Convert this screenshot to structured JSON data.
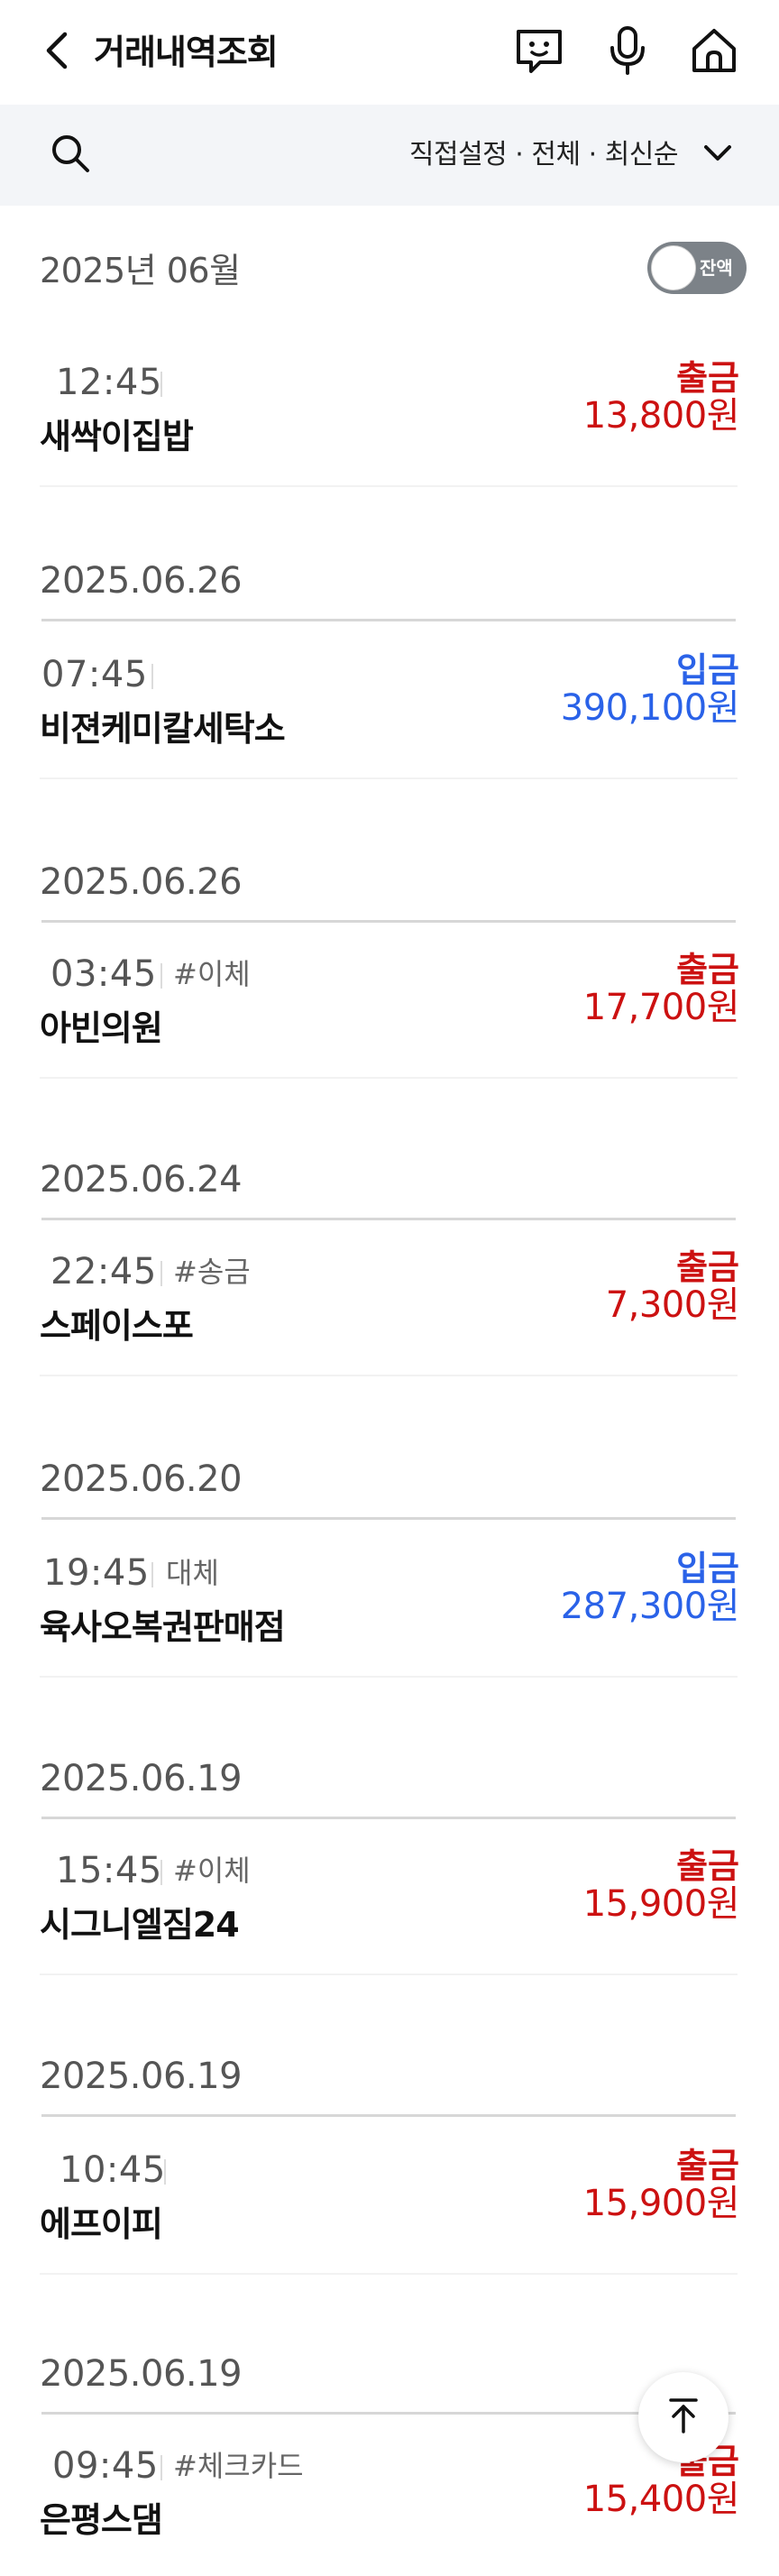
{
  "header": {
    "title": "거래내역조회",
    "icons": [
      "back-icon",
      "chatbot-icon",
      "microphone-icon",
      "home-icon"
    ]
  },
  "filter": {
    "summary": "직접설정 · 전체 · 최신순",
    "icons": [
      "search-icon",
      "chevron-down-icon"
    ]
  },
  "month": {
    "label": "2025년 06월",
    "balance_toggle_label": "잔액",
    "balance_toggle_on": false
  },
  "groups": [
    {
      "date": "",
      "items": [
        {
          "time": "12:45",
          "tag": "",
          "merchant": "새싹이집밥",
          "kind": "출금",
          "amount": "13,800원",
          "type": "withdraw"
        }
      ]
    },
    {
      "date": "2025.06.26",
      "items": [
        {
          "time": "07:45",
          "tag": "",
          "merchant": "비젼케미칼세탁소",
          "kind": "입금",
          "amount": "390,100원",
          "type": "deposit"
        }
      ]
    },
    {
      "date": "2025.06.26",
      "items": [
        {
          "time": "03:45",
          "tag": "#이체",
          "merchant": "아빈의원",
          "kind": "출금",
          "amount": "17,700원",
          "type": "withdraw"
        }
      ]
    },
    {
      "date": "2025.06.24",
      "items": [
        {
          "time": "22:45",
          "tag": "#송금",
          "merchant": "스페이스포",
          "kind": "출금",
          "amount": "7,300원",
          "type": "withdraw"
        }
      ]
    },
    {
      "date": "2025.06.20",
      "items": [
        {
          "time": "19:45",
          "tag": "대체",
          "merchant": "육사오복권판매점",
          "kind": "입금",
          "amount": "287,300원",
          "type": "deposit"
        }
      ]
    },
    {
      "date": "2025.06.19",
      "items": [
        {
          "time": "15:45",
          "tag": "#이체",
          "merchant": "시그니엘짐24",
          "kind": "출금",
          "amount": "15,900원",
          "type": "withdraw"
        }
      ]
    },
    {
      "date": "2025.06.19",
      "items": [
        {
          "time": "10:45",
          "tag": "",
          "merchant": "에프이피",
          "kind": "출금",
          "amount": "15,900원",
          "type": "withdraw"
        }
      ]
    },
    {
      "date": "2025.06.19",
      "items": [
        {
          "time": "09:45",
          "tag": "#체크카드",
          "merchant": "은평스댐",
          "kind": "출금",
          "amount": "15,400원",
          "type": "withdraw"
        }
      ]
    }
  ],
  "scroll_top_icon": "arrow-up-icon",
  "colors": {
    "withdraw": "#cc1111",
    "deposit": "#2a62e8",
    "filter_bar_bg": "#f3f5f8",
    "toggle_bg": "#7c8288"
  }
}
